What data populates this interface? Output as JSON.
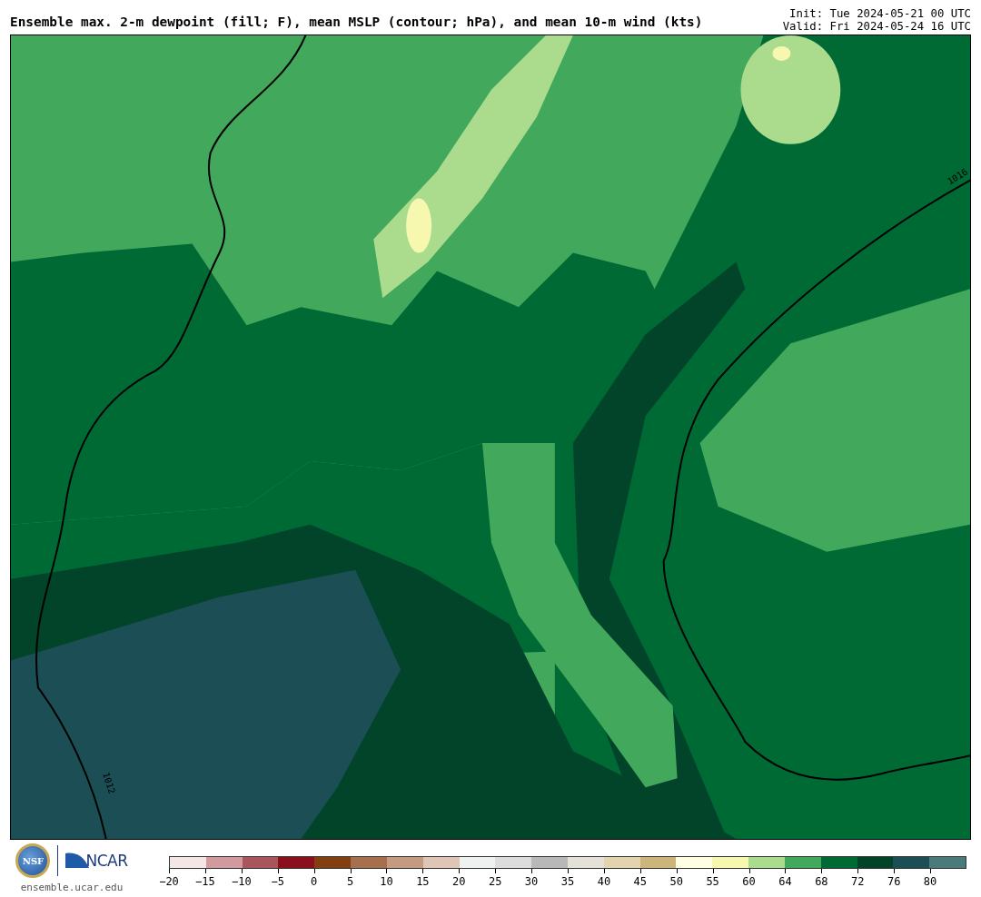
{
  "header": {
    "title": "Ensemble max. 2-m dewpoint (fill; F), mean MSLP (contour; hPa), and mean 10-m wind (kts)",
    "init": "Init: Tue 2024-05-21 00 UTC",
    "valid": "Valid: Fri 2024-05-24 16 UTC"
  },
  "map": {
    "contour_labels": [
      "1016",
      "1012"
    ]
  },
  "footer": {
    "logo_text": "NSF",
    "org": "NCAR",
    "site": "ensemble.ucar.edu"
  },
  "colorbar": {
    "segments": [
      {
        "color": "#f3e6e6",
        "label": "−20"
      },
      {
        "color": "#d09a9e",
        "label": "−15"
      },
      {
        "color": "#a8565c",
        "label": "−10"
      },
      {
        "color": "#8a101c",
        "label": "−5"
      },
      {
        "color": "#823f10",
        "label": "0"
      },
      {
        "color": "#a66f4e",
        "label": "5"
      },
      {
        "color": "#c49a80",
        "label": "10"
      },
      {
        "color": "#dfc5b5",
        "label": "15"
      },
      {
        "color": "#eff0f0",
        "label": "20"
      },
      {
        "color": "#dcdcdc",
        "label": "25"
      },
      {
        "color": "#b8b8b8",
        "label": "30"
      },
      {
        "color": "#e4e2d8",
        "label": "35"
      },
      {
        "color": "#e3d4b0",
        "label": "40"
      },
      {
        "color": "#cbb57a",
        "label": "45"
      },
      {
        "color": "#fefee2",
        "label": "50"
      },
      {
        "color": "#f6f8b0",
        "label": "55"
      },
      {
        "color": "#abdc8e",
        "label": "60"
      },
      {
        "color": "#41a85c",
        "label": "64"
      },
      {
        "color": "#006a35",
        "label": "68"
      },
      {
        "color": "#02442a",
        "label": "72"
      },
      {
        "color": "#1b4e55",
        "label": "76"
      },
      {
        "color": "#4b7a7a",
        "label": "80"
      }
    ]
  }
}
